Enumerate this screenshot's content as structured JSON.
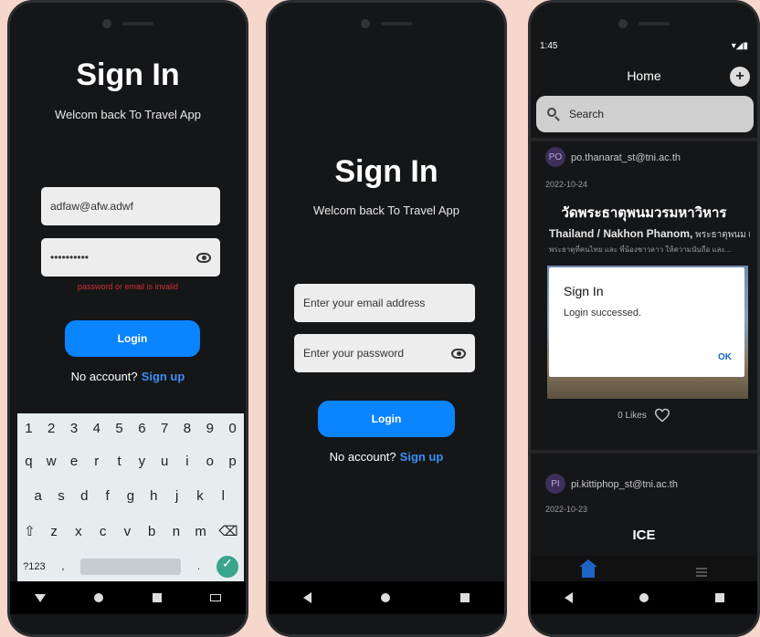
{
  "phone1": {
    "title": "Sign In",
    "subtitle": "Welcom back To Travel App",
    "email_value": "adfaw@afw.adwf",
    "password_value": "••••••••••",
    "error": "password or email is invalid",
    "login_label": "Login",
    "no_account": "No account?",
    "signup": "Sign up",
    "keyboard": {
      "row_numbers": [
        "1",
        "2",
        "3",
        "4",
        "5",
        "6",
        "7",
        "8",
        "9",
        "0"
      ],
      "row1": [
        "q",
        "w",
        "e",
        "r",
        "t",
        "y",
        "u",
        "i",
        "o",
        "p"
      ],
      "row2": [
        "a",
        "s",
        "d",
        "f",
        "g",
        "h",
        "j",
        "k",
        "l"
      ],
      "row3": [
        "z",
        "x",
        "c",
        "v",
        "b",
        "n",
        "m"
      ],
      "symbols_key": "?123",
      "comma_key": ",",
      "period_key": "."
    }
  },
  "phone2": {
    "title": "Sign In",
    "subtitle": "Welcom back To Travel App",
    "email_placeholder": "Enter your email address",
    "password_placeholder": "Enter your password",
    "login_label": "Login",
    "no_account": "No account?",
    "signup": "Sign up"
  },
  "phone3": {
    "status_time": "1:45",
    "header_title": "Home",
    "add_label": "+",
    "search_placeholder": "Search",
    "post1": {
      "avatar": "PO",
      "email": "po.thanarat_st@tni.ac.th",
      "date": "2022-10-24",
      "title": "วัดพระธาตุพนมวรมหาวิหาร",
      "location": "Thailand / Nakhon Phanom,",
      "desc_line1": "พระธาตุพนม เป็น",
      "desc_line2": "พระธาตุที่คนไทย และ พี่น้องชาวลาว ให้ความนับถือ และ...",
      "likes": "0 Likes"
    },
    "dialog": {
      "title": "Sign In",
      "message": "Login successed.",
      "ok": "OK"
    },
    "post2": {
      "avatar": "PI",
      "email": "pi.kittiphop_st@tni.ac.th",
      "date": "2022-10-23",
      "title": "ICE"
    }
  },
  "colors": {
    "accent": "#0a84ff",
    "link": "#3a8ff5",
    "error": "#d32f2f",
    "background": "#151618",
    "frame": "#f6d7cc"
  }
}
